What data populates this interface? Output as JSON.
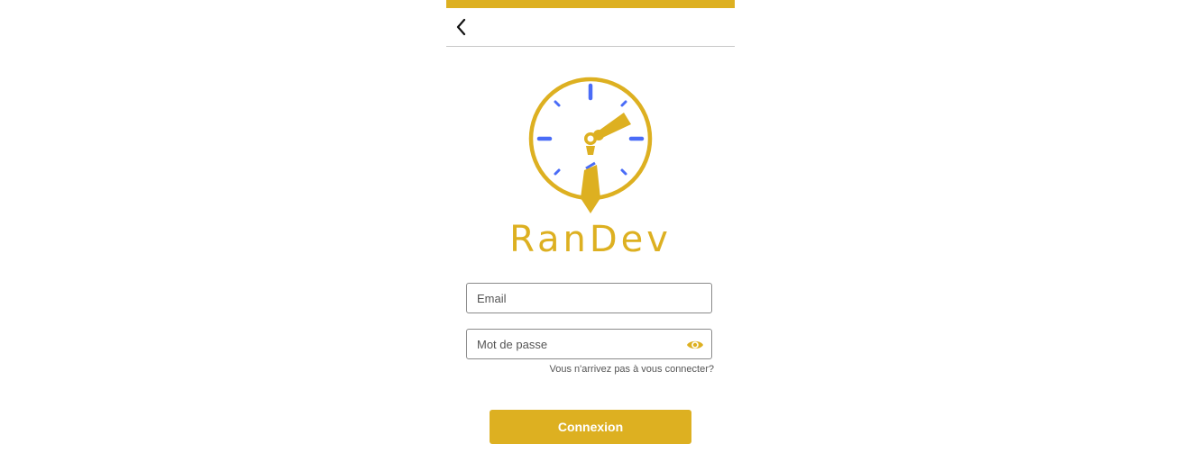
{
  "app": {
    "brand_name": "RanDev",
    "colors": {
      "accent": "#ddb021",
      "clock_ticks": "#4a6cf7",
      "divider": "#c8c8c8",
      "field_border": "#8a8a8a"
    }
  },
  "header": {
    "back_icon": "chevron-left-icon"
  },
  "logo": {
    "icon": "clock-tie-logo"
  },
  "form": {
    "email": {
      "placeholder": "Email",
      "value": ""
    },
    "password": {
      "placeholder": "Mot de passe",
      "value": "",
      "toggle_icon": "eye-icon"
    },
    "forgot_label": "Vous n'arrivez pas à vous connecter?",
    "submit_label": "Connexion"
  }
}
